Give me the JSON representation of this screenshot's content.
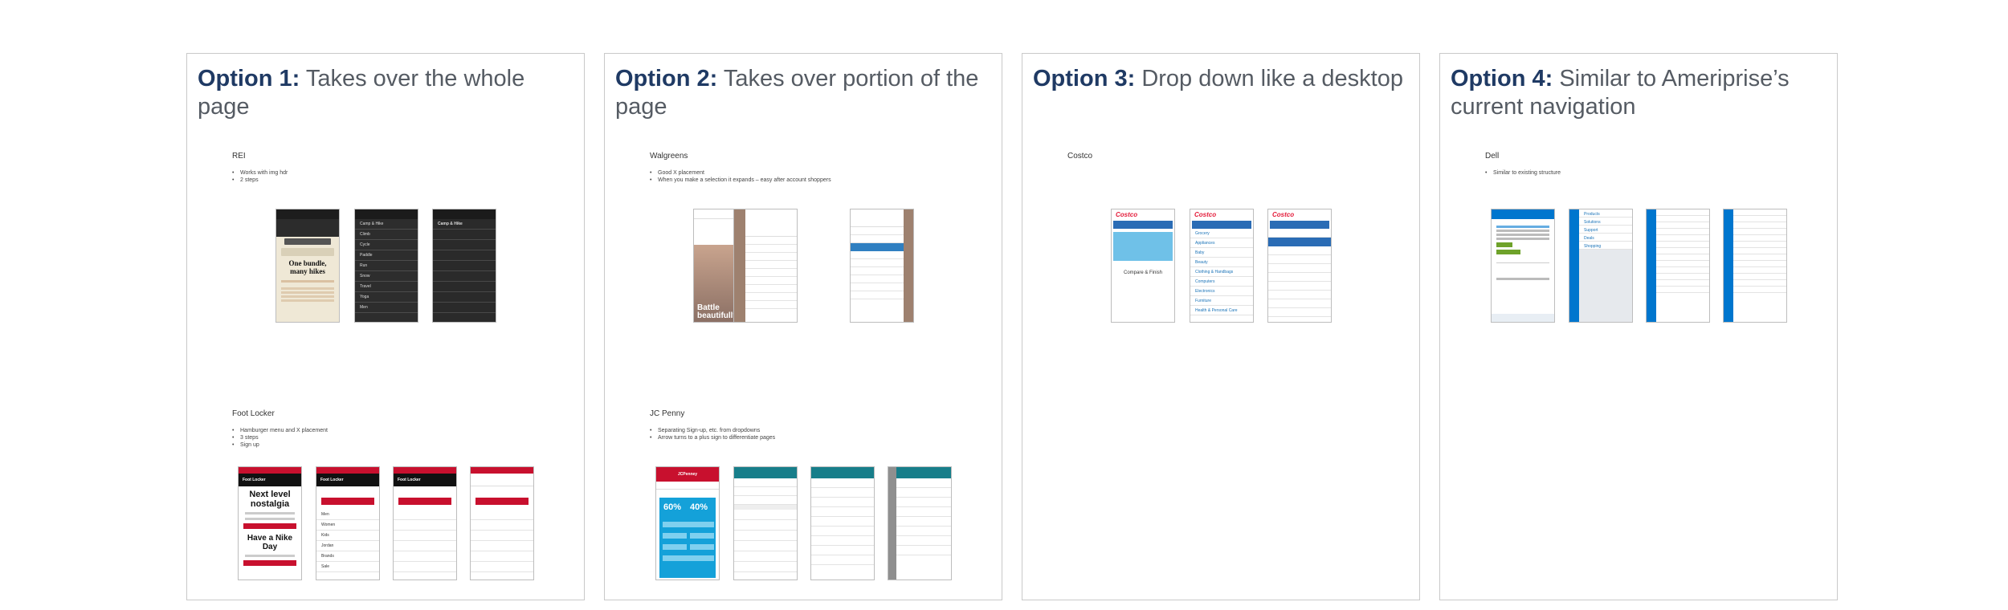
{
  "options": [
    {
      "number": "Option 1:",
      "title": "Takes over the whole page",
      "sections": [
        {
          "name": "REI",
          "bullets": [
            "Works with img hdr",
            "2 steps"
          ]
        },
        {
          "name": "Foot Locker",
          "bullets": [
            "Hamburger menu and X placement",
            "3 steps",
            "Sign up"
          ]
        }
      ]
    },
    {
      "number": "Option 2:",
      "title": "Takes over portion of the page",
      "sections": [
        {
          "name": "Walgreens",
          "bullets": [
            "Good X placement",
            "When you make a selection it expands – easy after account shoppers"
          ]
        },
        {
          "name": "JC Penny",
          "bullets": [
            "Separating Sign-up, etc. from dropdowns",
            "Arrow turns to a plus sign to differentiate pages"
          ]
        }
      ]
    },
    {
      "number": "Option 3:",
      "title": "Drop down like a desktop",
      "sections": [
        {
          "name": "Costco",
          "bullets": []
        }
      ]
    },
    {
      "number": "Option 4:",
      "title": "Similar to Ameriprise’s current navigation",
      "sections": [
        {
          "name": "Dell",
          "bullets": [
            "Similar to existing structure"
          ]
        }
      ]
    }
  ],
  "phone_text": {
    "rei_hero1": "One bundle,",
    "rei_hero2": "many hikes",
    "rei_menu": [
      "Camp & Hike",
      "Climb",
      "Cycle",
      "Paddle",
      "Run",
      "Snow",
      "Travel",
      "Yoga",
      "Men"
    ],
    "fl_logo": "Foot Locker",
    "fl_hero1": "Next level",
    "fl_hero2": "nostalgia",
    "fl_hero3": "Have a Nike",
    "fl_hero4": "Day",
    "fl_menu": [
      "Men",
      "Women",
      "Kids",
      "Jordan",
      "Brands",
      "Sale"
    ],
    "wg_hero1": "Battle",
    "wg_hero2": "beautifully",
    "jcp_logo": "JCPenney",
    "jcp_sale1": "60%",
    "jcp_sale2": "40%",
    "costco_logo": "Costco",
    "costco_mid": "Compare & Finish",
    "costco_menu": [
      "Grocery",
      "Appliances",
      "Baby",
      "Beauty",
      "Clothing & Handbags",
      "Computers",
      "Electronics",
      "Furniture",
      "Health & Personal Care"
    ],
    "dell_menu": [
      "Products",
      "Solutions",
      "Support",
      "Deals",
      "Shopping"
    ]
  }
}
